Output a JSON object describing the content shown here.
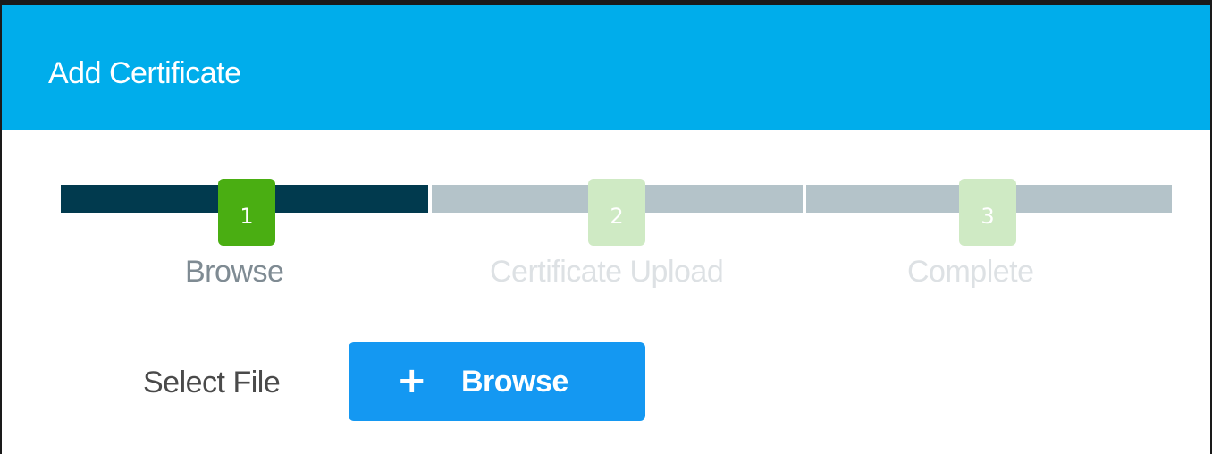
{
  "header": {
    "title": "Add Certificate"
  },
  "stepper": {
    "steps": [
      {
        "number": "1",
        "label": "Browse",
        "state": "active"
      },
      {
        "number": "2",
        "label": "Certificate Upload",
        "state": "inactive"
      },
      {
        "number": "3",
        "label": "Complete",
        "state": "inactive"
      }
    ]
  },
  "form": {
    "select_file_label": "Select File",
    "browse_button": {
      "icon": "plus-icon",
      "icon_glyph": "+",
      "label": "Browse"
    }
  },
  "colors": {
    "header_bg": "#00adeb",
    "active_step": "#4aae12",
    "inactive_step": "#cfeac4",
    "progress_done": "#013a4e",
    "progress_pending": "#b4c3c9",
    "button_bg": "#1498f2"
  }
}
